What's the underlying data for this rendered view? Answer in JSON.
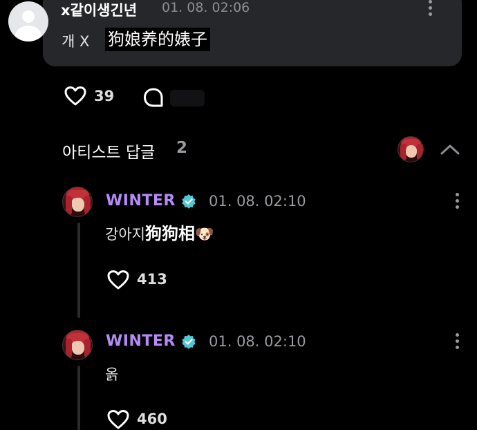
{
  "colors": {
    "background": "#000000",
    "card": "#26272b",
    "artist_name": "#b58cf5",
    "verified": "#53c7d4",
    "muted": "#9a9ba0"
  },
  "comment": {
    "author": "x같이생긴년",
    "time": "01. 08. 02:06",
    "text_ko": "개 X",
    "text_zh": "狗娘养的婊子",
    "likes": "39",
    "icons": {
      "avatar": "default-profile-icon",
      "more": "more-vertical-icon",
      "like": "heart-outline-icon",
      "reply": "comment-bubble-icon"
    }
  },
  "artist_replies": {
    "title": "아티스트 답글",
    "count": "2",
    "icons": {
      "collapse": "chevron-up-icon"
    },
    "items": [
      {
        "author": "WINTER",
        "time": "01. 08. 02:10",
        "text_ko": "강아지",
        "text_zh": "狗狗相",
        "emoji": "🐶",
        "likes": "413"
      },
      {
        "author": "WINTER",
        "time": "01. 08. 02:10",
        "text_ko": "옭",
        "text_zh": "",
        "emoji": "",
        "likes": "460"
      }
    ]
  }
}
